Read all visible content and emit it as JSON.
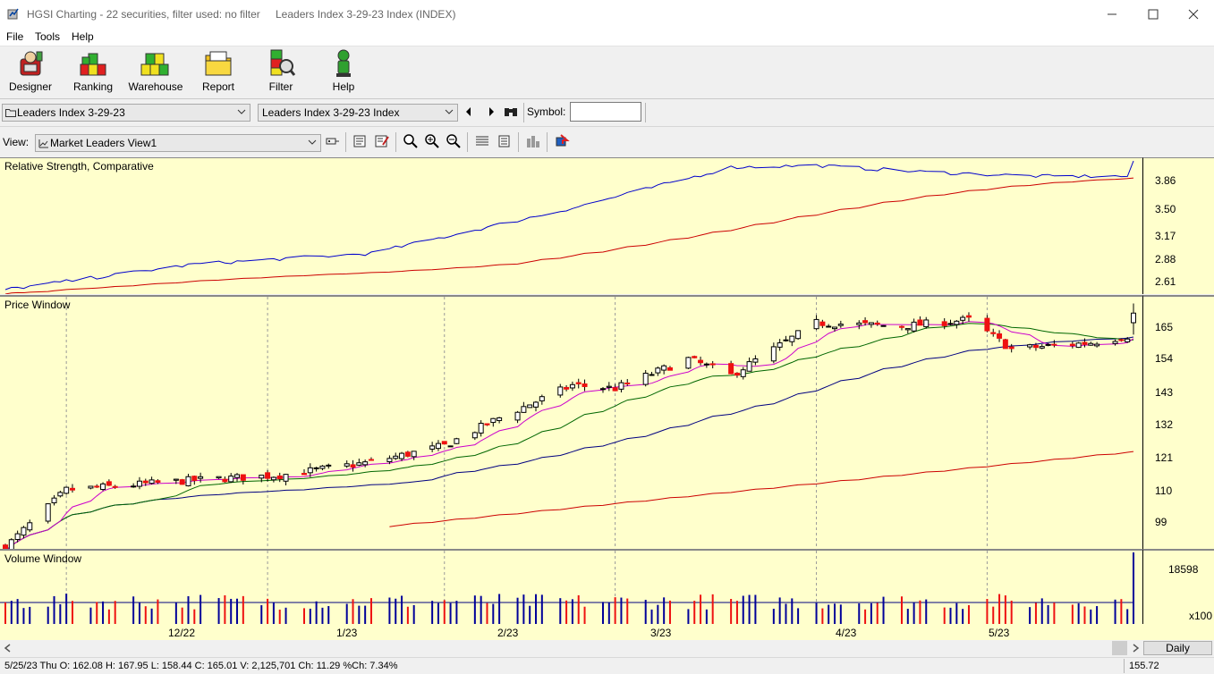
{
  "window": {
    "title": "HGSI Charting - 22 securities, filter used: no filter",
    "subtitle": "Leaders Index 3-29-23 Index (INDEX)"
  },
  "menu": [
    "File",
    "Tools",
    "Help"
  ],
  "toolbar": {
    "buttons": [
      {
        "label": "Designer",
        "icon": "designer-icon"
      },
      {
        "label": "Ranking",
        "icon": "ranking-icon"
      },
      {
        "label": "Warehouse",
        "icon": "warehouse-icon"
      },
      {
        "label": "Report",
        "icon": "report-icon"
      },
      {
        "label": "Filter",
        "icon": "filter-icon"
      },
      {
        "label": "Help",
        "icon": "help-icon"
      }
    ]
  },
  "selectors": {
    "list": "Leaders Index 3-29-23",
    "security": "Leaders Index 3-29-23 Index",
    "symbol_label": "Symbol:",
    "symbol_value": ""
  },
  "view": {
    "label": "View:",
    "value": "Market Leaders View1"
  },
  "panels": {
    "rs": {
      "title": "Relative Strength, Comparative",
      "ticks": [
        "3.86",
        "3.50",
        "3.17",
        "2.88",
        "2.61"
      ]
    },
    "price": {
      "title": "Price Window",
      "ticks": [
        "165",
        "154",
        "143",
        "132",
        "121",
        "110",
        "99"
      ]
    },
    "volume": {
      "title": "Volume Window",
      "ticks": [
        "18598"
      ],
      "unit": "x100"
    }
  },
  "dates": [
    "12/22",
    "1/23",
    "2/23",
    "3/23",
    "4/23",
    "5/23"
  ],
  "period": "Daily",
  "status": {
    "ohlc": "5/25/23 Thu O: 162.08 H: 167.95 L: 158.44 C: 165.01 V: 2,125,701 Ch: 11.29 %Ch: 7.34%",
    "cursor_value": "155.72"
  },
  "colors": {
    "panel_bg": "#ffffcc",
    "rs_line": "#0000cc",
    "rs_avg": "#cc0000",
    "up_candle": "#ffffff",
    "down_candle": "#ee1111",
    "ma_short": "#cc00cc",
    "ma_mid": "#006600",
    "ma_long": "#000080",
    "ma_200": "#cc0000",
    "vol_up": "#000099",
    "vol_down": "#ee1111"
  },
  "chart_data": {
    "type": "candlestick",
    "x_range": [
      "2022-11-21",
      "2023-05-25"
    ],
    "price_axis": [
      93,
      170
    ],
    "rs_axis": [
      2.55,
      4.05
    ],
    "price_path_waypoints": [
      {
        "date": "2022-11-21",
        "close": 93.5
      },
      {
        "date": "2022-12-01",
        "close": 111
      },
      {
        "date": "2022-12-22",
        "close": 114
      },
      {
        "date": "2023-01-05",
        "close": 115.5
      },
      {
        "date": "2023-01-20",
        "close": 119.5
      },
      {
        "date": "2023-02-01",
        "close": 124.5
      },
      {
        "date": "2023-02-10",
        "close": 133
      },
      {
        "date": "2023-02-22",
        "close": 143
      },
      {
        "date": "2023-03-01",
        "close": 142
      },
      {
        "date": "2023-03-13",
        "close": 151
      },
      {
        "date": "2023-03-20",
        "close": 146
      },
      {
        "date": "2023-04-03",
        "close": 162
      },
      {
        "date": "2023-04-17",
        "close": 161
      },
      {
        "date": "2023-04-28",
        "close": 163
      },
      {
        "date": "2023-05-05",
        "close": 154
      },
      {
        "date": "2023-05-18",
        "close": 156
      },
      {
        "date": "2023-05-24",
        "close": 158
      },
      {
        "date": "2023-05-25",
        "close": 165.01
      }
    ],
    "last_bar": {
      "date": "2023-05-25",
      "open": 162.08,
      "high": 167.95,
      "low": 158.44,
      "close": 165.01,
      "volume": 2125701
    },
    "rs_path_waypoints": [
      {
        "date": "2022-11-21",
        "value": 2.6
      },
      {
        "date": "2022-12-22",
        "value": 2.88
      },
      {
        "date": "2023-01-20",
        "value": 3.0
      },
      {
        "date": "2023-02-22",
        "value": 3.5
      },
      {
        "date": "2023-03-20",
        "value": 3.95
      },
      {
        "date": "2023-04-03",
        "value": 3.97
      },
      {
        "date": "2023-04-20",
        "value": 3.9
      },
      {
        "date": "2023-05-10",
        "value": 3.85
      },
      {
        "date": "2023-05-24",
        "value": 3.85
      },
      {
        "date": "2023-05-25",
        "value": 4.0
      }
    ]
  }
}
